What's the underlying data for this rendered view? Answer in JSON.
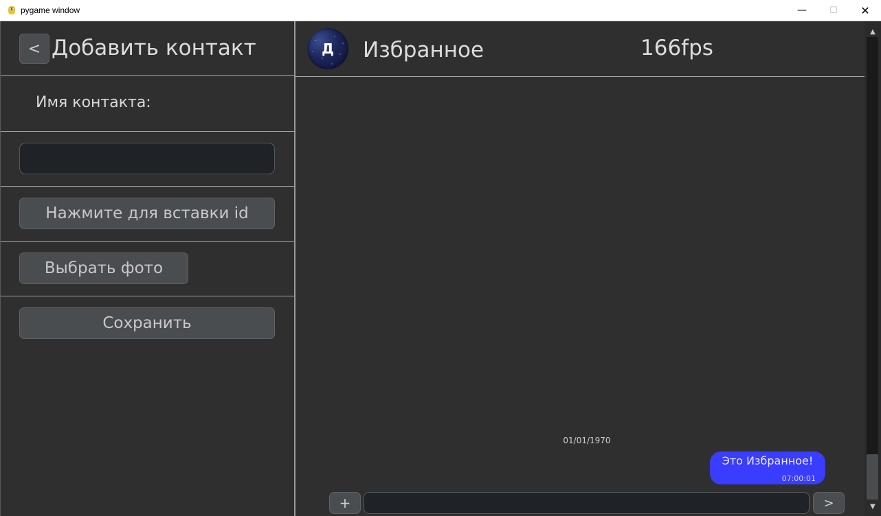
{
  "window": {
    "title": "pygame window",
    "minimize_glyph": "—",
    "maximize_glyph": "☐",
    "close_glyph": "✕"
  },
  "left": {
    "back_label": "<",
    "title": "Добавить контакт",
    "name_label": "Имя контакта:",
    "name_value": "",
    "paste_id_label": "Нажмите для вставки id",
    "choose_photo_label": "Выбрать фото",
    "save_label": "Сохранить"
  },
  "chat": {
    "avatar_letter": "Д",
    "title": "Избранное",
    "fps": "166fps",
    "date": "01/01/1970",
    "messages": [
      {
        "text": "Это Избранное!",
        "time": "07:00:01",
        "color": "#3a3cff"
      }
    ],
    "input_value": "",
    "plus_label": "+",
    "send_label": ">"
  },
  "scrollbar": {
    "up_glyph": "▲",
    "down_glyph": "▼"
  },
  "colors": {
    "background": "#2f2f2f",
    "bubble": "#3a3cff",
    "button": "#4a4d50",
    "input": "#1f2327"
  }
}
